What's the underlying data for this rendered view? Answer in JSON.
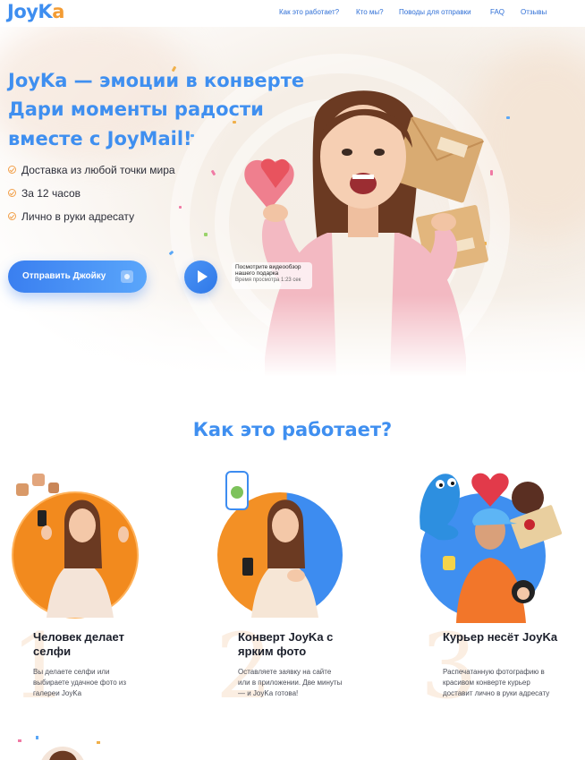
{
  "header": {
    "logo_main": "JoyK",
    "logo_accent": "a",
    "nav": [
      {
        "label": "Как это работает?"
      },
      {
        "label": "Кто мы?"
      },
      {
        "label": "Поводы для отправки"
      },
      {
        "label": "FAQ"
      },
      {
        "label": "Отзывы"
      }
    ]
  },
  "hero": {
    "title_line1": "JoyKa — эмоции в конверте",
    "title_line2": "Дари моменты радости",
    "title_line3": "вместе с JoyMail!",
    "features": [
      {
        "label": "Доставка из любой точки мира"
      },
      {
        "label": "За 12 часов"
      },
      {
        "label": "Лично в руки адресату"
      }
    ],
    "send_button": "Отправить Джойку",
    "video_line1": "Посмотрите видеообзор",
    "video_line2": "нашего подарка",
    "video_line3": "Время просмотра 1:23 сек"
  },
  "how": {
    "title": "Как это работает?",
    "steps": [
      {
        "num": "1",
        "title": "Человек делает селфи",
        "desc": "Вы делаете селфи или выбираете удачное фото из галереи JoyKa"
      },
      {
        "num": "2",
        "title": "Конверт JoyKa с ярким фото",
        "desc": "Оставляете заявку на сайте или в приложении. Две минуты — и JoyKa готова!"
      },
      {
        "num": "3",
        "title": "Курьер несёт JoyKa",
        "desc": "Распечатанную фотографию в красивом конверте курьер доставит лично в руки адресату"
      }
    ]
  },
  "colors": {
    "brand_blue": "#3f8ff0",
    "brand_orange": "#f39c34",
    "text_dark": "#1b1f2b"
  },
  "icons": [
    "check-circle-icon",
    "gift-icon",
    "play-icon"
  ]
}
